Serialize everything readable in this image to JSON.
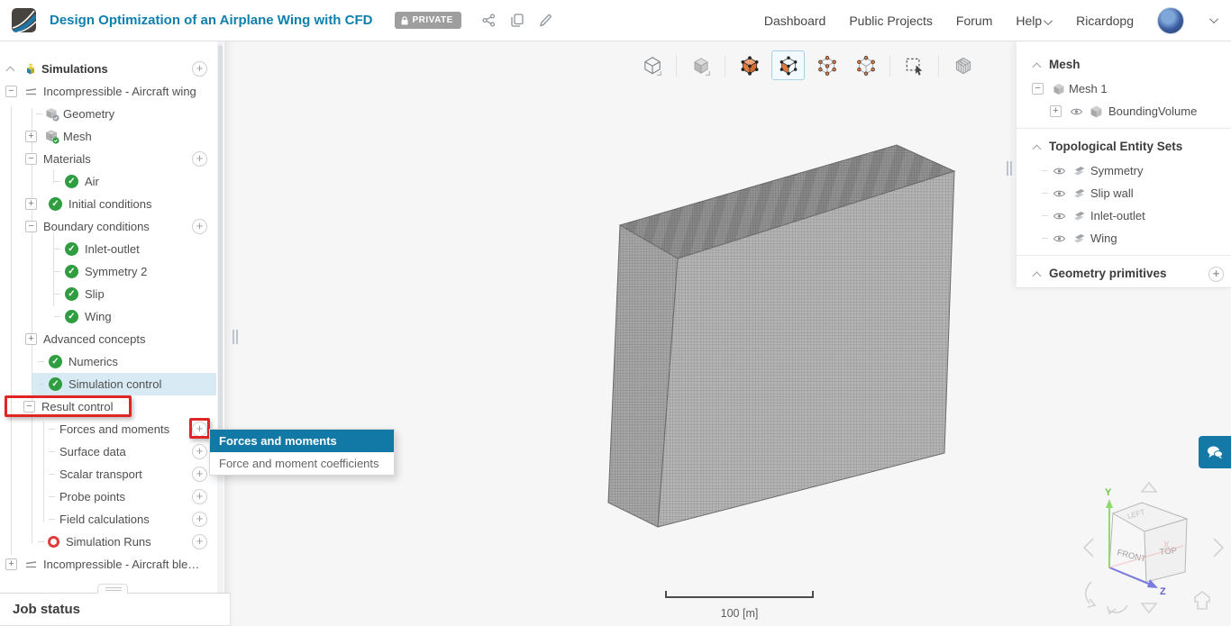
{
  "header": {
    "title": "Design Optimization of an Airplane Wing with CFD",
    "privacy_badge": "PRIVATE",
    "nav": [
      "Dashboard",
      "Public Projects",
      "Forum",
      "Help"
    ],
    "username": "Ricardopg"
  },
  "sidebar": {
    "items": [
      {
        "label": "Simulations"
      },
      {
        "label": "Incompressible - Aircraft wing"
      },
      {
        "label": "Geometry"
      },
      {
        "label": "Mesh"
      },
      {
        "label": "Materials"
      },
      {
        "label": "Air"
      },
      {
        "label": "Initial conditions"
      },
      {
        "label": "Boundary conditions"
      },
      {
        "label": "Inlet-outlet"
      },
      {
        "label": "Symmetry 2"
      },
      {
        "label": "Slip"
      },
      {
        "label": "Wing"
      },
      {
        "label": "Advanced concepts"
      },
      {
        "label": "Numerics"
      },
      {
        "label": "Simulation control"
      },
      {
        "label": "Result control"
      },
      {
        "label": "Forces and moments"
      },
      {
        "label": "Surface data"
      },
      {
        "label": "Scalar transport"
      },
      {
        "label": "Probe points"
      },
      {
        "label": "Field calculations"
      },
      {
        "label": "Simulation Runs"
      },
      {
        "label": "Incompressible - Aircraft blen..."
      }
    ]
  },
  "context_menu": {
    "items": [
      {
        "label": "Forces and moments",
        "selected": true
      },
      {
        "label": "Force and moment coefficients",
        "selected": false
      }
    ]
  },
  "scene_panel": {
    "sections": [
      {
        "header": "Mesh",
        "items": [
          {
            "label": "Mesh 1"
          },
          {
            "label": "BoundingVolume"
          }
        ]
      },
      {
        "header": "Topological Entity Sets",
        "items": [
          {
            "label": "Symmetry"
          },
          {
            "label": "Slip wall"
          },
          {
            "label": "Inlet-outlet"
          },
          {
            "label": "Wing"
          }
        ]
      },
      {
        "header": "Geometry primitives",
        "items": []
      }
    ]
  },
  "viewport": {
    "scale_label": "100 [m]",
    "toolbar_icons": [
      "wireframe-view",
      "shaded-view",
      "surface-wireframe-view",
      "surface-mesh-view",
      "node-view",
      "vertex-view",
      "box-select",
      "mesh-display"
    ],
    "active_toolbar_index": 3,
    "nav_cube": {
      "front": "FRONT",
      "top": "TOP",
      "left": "LEFT",
      "axis_x": "X",
      "axis_y": "Y",
      "axis_z": "Z"
    }
  },
  "job_status": {
    "title": "Job status"
  },
  "colors": {
    "brand_blue": "#0f7fae",
    "menu_highlight": "#1278a5",
    "success_green": "#2e9e41",
    "annotation_red": "#e02525",
    "selected_row": "#d8eaf4",
    "private_badge": "#9e9e9e"
  }
}
